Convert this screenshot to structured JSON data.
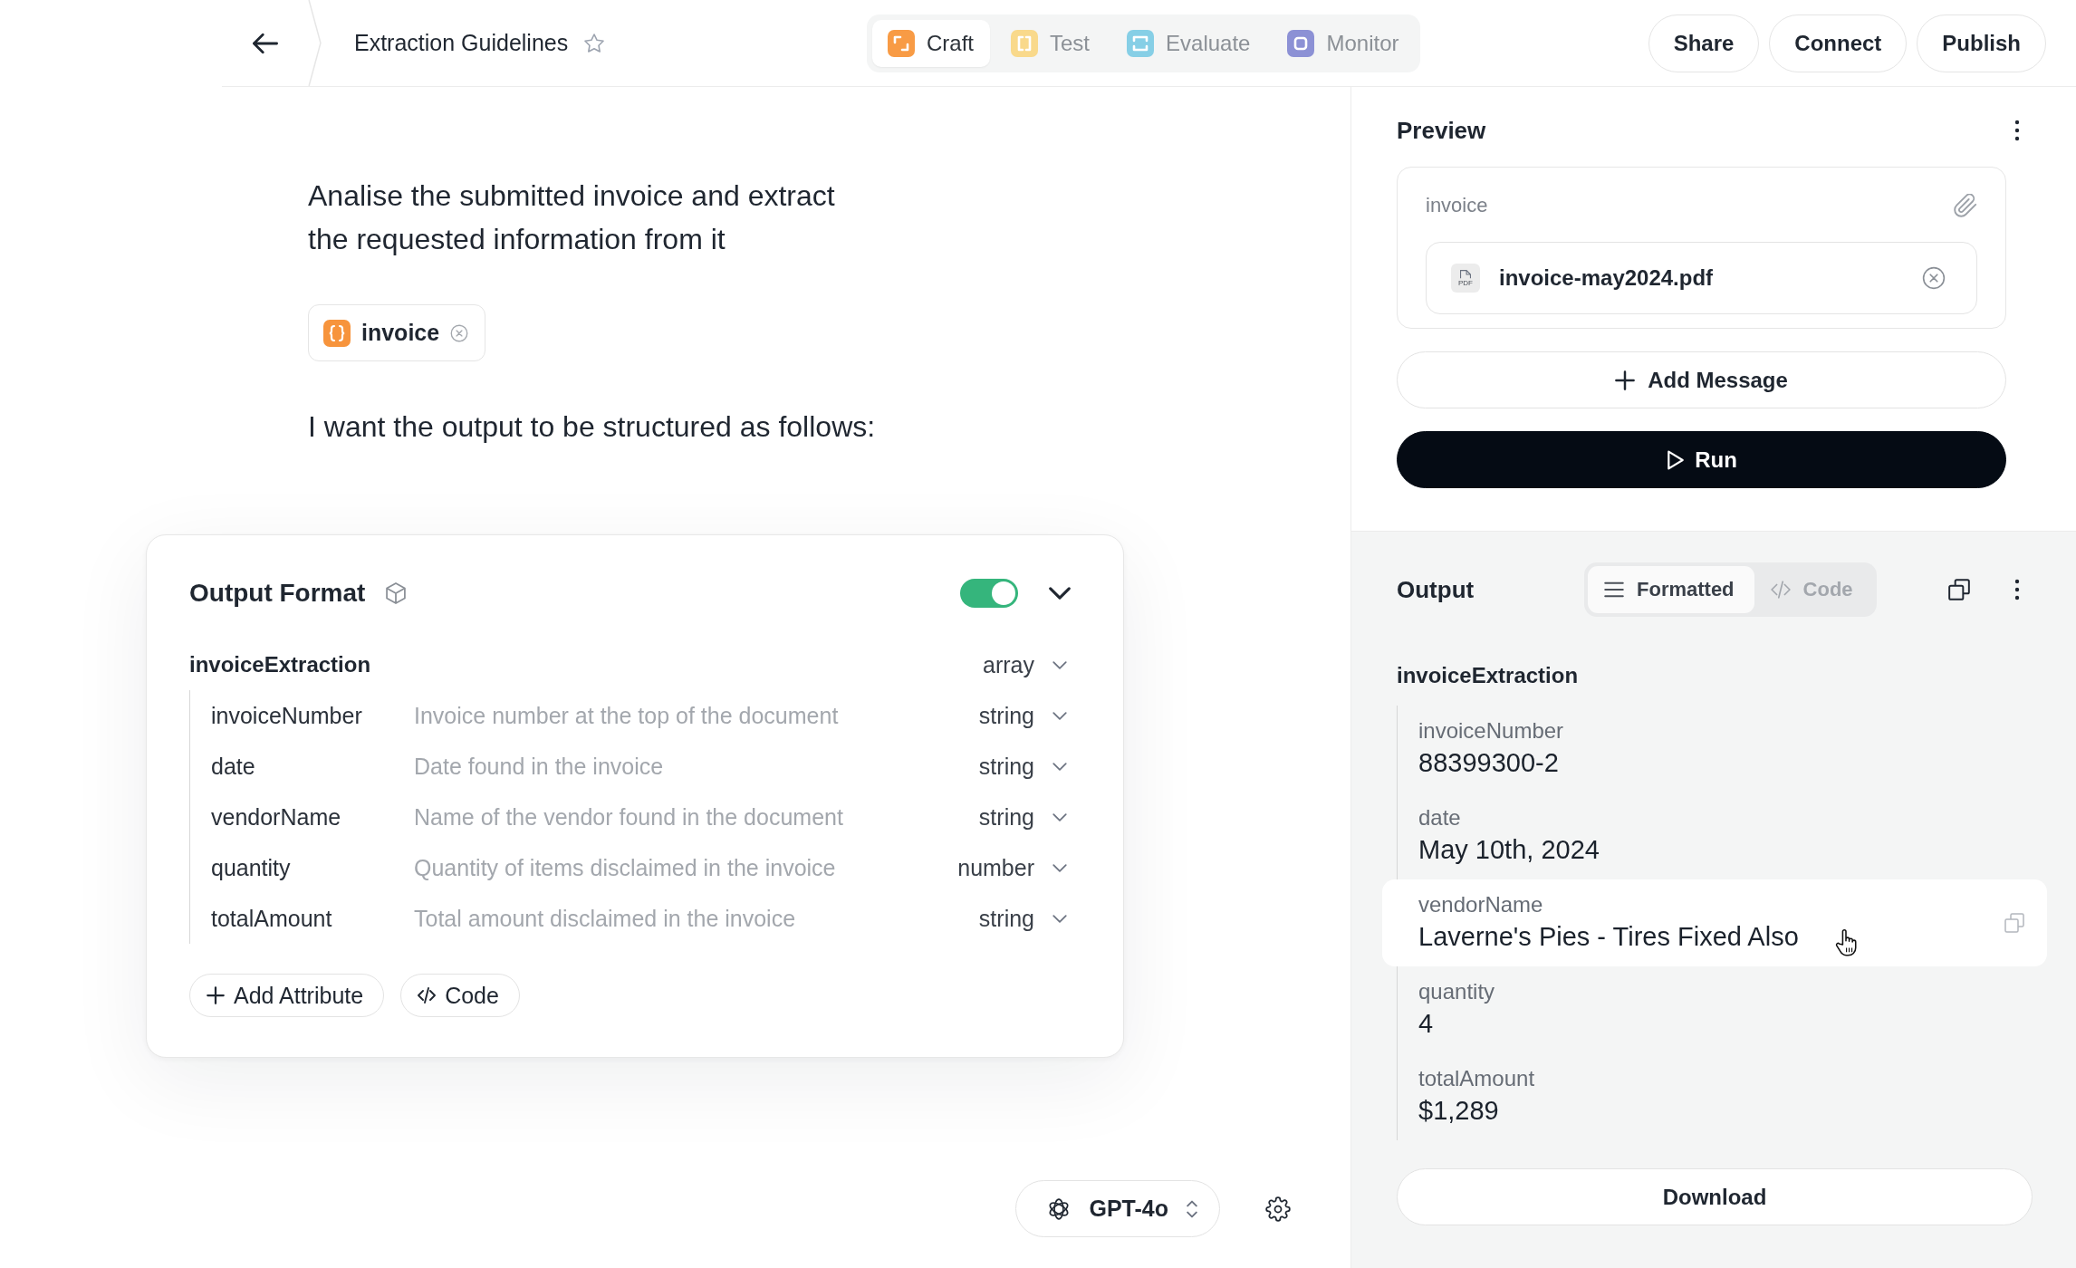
{
  "header": {
    "title": "Extraction Guidelines",
    "starred": false,
    "tabs": [
      {
        "label": "Craft",
        "selected": true,
        "color": "#f89b45"
      },
      {
        "label": "Test",
        "selected": false,
        "color": "#f9d98b"
      },
      {
        "label": "Evaluate",
        "selected": false,
        "color": "#86cfe6"
      },
      {
        "label": "Monitor",
        "selected": false,
        "color": "#8c91d5"
      }
    ],
    "actions": [
      "Share",
      "Connect",
      "Publish"
    ]
  },
  "prompt": [
    {
      "kind": "text",
      "lines": [
        "Analise the submitted invoice and extract",
        "the requested information from it"
      ]
    },
    {
      "kind": "variable",
      "label": "invoice"
    },
    {
      "kind": "text",
      "lines": [
        "I want the output to be structured as follows:"
      ]
    }
  ],
  "output_format": {
    "title": "Output Format",
    "enabled": true,
    "schema": {
      "name": "invoiceExtraction",
      "type": "array",
      "children": [
        {
          "name": "invoiceNumber",
          "description": "Invoice number at the top of the document",
          "type": "string"
        },
        {
          "name": "date",
          "description": "Date found in the invoice",
          "type": "string"
        },
        {
          "name": "vendorName",
          "description": "Name of the vendor found in the document",
          "type": "string"
        },
        {
          "name": "quantity",
          "description": "Quantity of items disclaimed in the invoice",
          "type": "number"
        },
        {
          "name": "totalAmount",
          "description": "Total amount disclaimed in the invoice",
          "type": "string"
        }
      ]
    },
    "buttons": [
      {
        "kind": "add",
        "label": "Add Attribute"
      },
      {
        "kind": "code",
        "label": "Code"
      }
    ]
  },
  "model_selector": {
    "model": "GPT-4o"
  },
  "preview": {
    "title": "Preview",
    "input": {
      "label": "invoice",
      "file_type": "PDF",
      "file": "invoice-may2024.pdf"
    },
    "buttons": [
      {
        "kind": "add",
        "label": "Add Message"
      },
      {
        "kind": "run",
        "label": "Run"
      }
    ]
  },
  "output": {
    "title": "Output",
    "view_tabs": [
      {
        "label": "Formatted",
        "selected": true
      },
      {
        "label": "Code",
        "selected": false
      }
    ],
    "result": {
      "name": "invoiceExtraction",
      "children": [
        {
          "label": "invoiceNumber",
          "value": "88399300-2",
          "hovered": false
        },
        {
          "label": "date",
          "value": "May 10th, 2024",
          "hovered": false
        },
        {
          "label": "vendorName",
          "value": "Laverne's Pies - Tires Fixed Also",
          "hovered": true
        },
        {
          "label": "quantity",
          "value": "4",
          "hovered": false
        },
        {
          "label": "totalAmount",
          "value": "$1,289",
          "hovered": false
        }
      ]
    },
    "download": "Download"
  }
}
